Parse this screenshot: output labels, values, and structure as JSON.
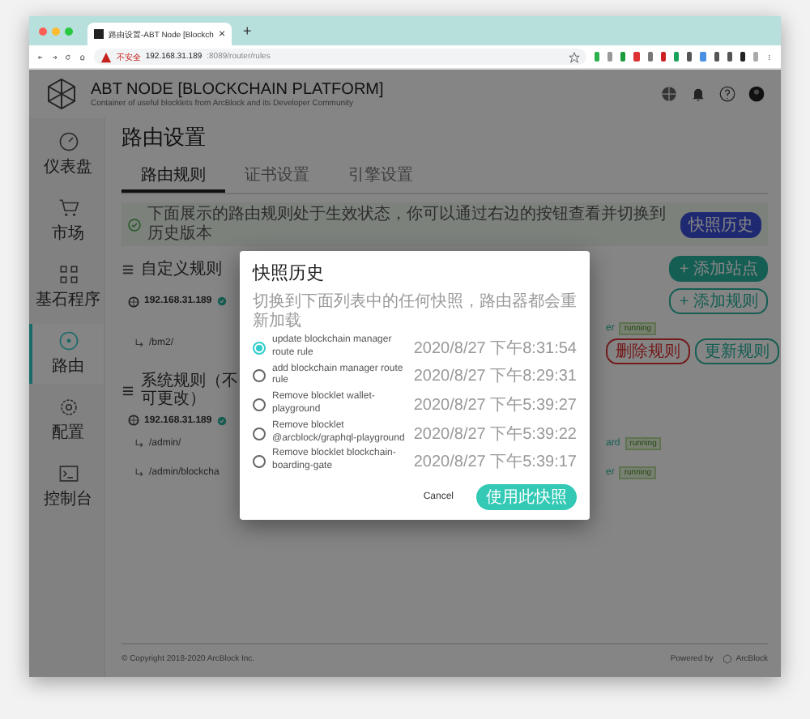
{
  "browser": {
    "tab_title": "路由设置-ABT Node [Blockch",
    "tab_close": "×",
    "new_tab": "+",
    "security": "不安全",
    "url_host": "192.168.31.189",
    "url_path": ":8089/router/rules"
  },
  "header": {
    "title": "ABT NODE [BLOCKCHAIN PLATFORM]",
    "subtitle": "Container of useful blocklets from ArcBlock and its Developer Community"
  },
  "sidebar": {
    "items": [
      {
        "kind": "gauge",
        "label": "仪表盘",
        "selected": false
      },
      {
        "kind": "cart",
        "label": "市场",
        "selected": false
      },
      {
        "kind": "blocks",
        "label": "基石程序",
        "selected": false
      },
      {
        "kind": "router",
        "label": "路由",
        "selected": true
      },
      {
        "kind": "gear",
        "label": "配置",
        "selected": false
      },
      {
        "kind": "console",
        "label": "控制台",
        "selected": false
      }
    ]
  },
  "page": {
    "title": "路由设置",
    "tabs": [
      {
        "label": "路由规则",
        "selected": true
      },
      {
        "label": "证书设置",
        "selected": false
      },
      {
        "label": "引擎设置",
        "selected": false
      }
    ],
    "alert": {
      "text": "下面展示的路由规则处于生效状态，你可以通过右边的按钮查看并切换到历史版本",
      "button": "快照历史"
    },
    "sections": [
      {
        "title": "自定义规则",
        "add_site": "+ 添加站点",
        "sites": [
          {
            "host": "192.168.31.189",
            "verified": true,
            "add_rule": "+ 添加规则",
            "rules": [
              {
                "path": "/bm2/",
                "target": "er",
                "status": "running",
                "delete": "删除规则",
                "update": "更新规则"
              }
            ]
          }
        ]
      },
      {
        "title": "系统规则（不可更改）",
        "sites": [
          {
            "host": "192.168.31.189",
            "verified": true,
            "rules": [
              {
                "path": "/admin/",
                "target": "ard",
                "status": "running"
              },
              {
                "path": "/admin/blockcha",
                "target": "er",
                "status": "running"
              }
            ]
          }
        ]
      }
    ]
  },
  "footer": {
    "copyright": "© Copyright 2018-2020 ArcBlock Inc.",
    "powered_by": "Powered by",
    "brand": "ArcBlock"
  },
  "dialog": {
    "title": "快照历史",
    "subtitle": "切换到下面列表中的任何快照，路由器都会重新加载",
    "snapshots": [
      {
        "message": "update blockchain manager route rule",
        "time": "2020/8/27 下午8:31:54",
        "selected": true
      },
      {
        "message": "add blockchain manager route rule",
        "time": "2020/8/27 下午8:29:31",
        "selected": false
      },
      {
        "message": "Remove blocklet wallet-playground",
        "time": "2020/8/27 下午5:39:27",
        "selected": false
      },
      {
        "message": "Remove blocklet @arcblock/graphql-playground",
        "time": "2020/8/27 下午5:39:22",
        "selected": false
      },
      {
        "message": "Remove blocklet blockchain-boarding-gate",
        "time": "2020/8/27 下午5:39:17",
        "selected": false
      }
    ],
    "cancel": "Cancel",
    "confirm": "使用此快照"
  }
}
